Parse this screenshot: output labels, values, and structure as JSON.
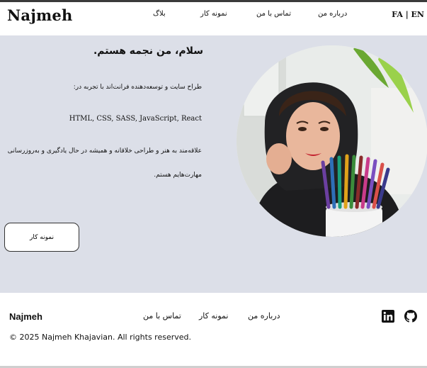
{
  "header": {
    "logo": "Najmeh",
    "nav": {
      "blog": "بلاگ",
      "portfolio": "نمونه کار",
      "contact": "تماس با من",
      "about": "درباره من"
    },
    "lang": {
      "fa": "FA",
      "sep": " | ",
      "en": "EN"
    }
  },
  "hero": {
    "title": "سلام، من نجمه هستم.",
    "intro": "طراح سایت و توسعه‌دهنده فرانت‌اند با تجربه در:",
    "skills": "HTML, CSS, SASS, JavaScript, React",
    "passion_line1": "علاقه‌مند به هنر و طراحی خلاقانه و همیشه در حال یادگیری و به‌روزرسانی",
    "passion_line2": "مهارت‌هایم هستم.",
    "cta": "نمونه کار"
  },
  "footer": {
    "logo": "Najmeh",
    "nav": {
      "contact": "تماس با من",
      "portfolio": "نمونه کار",
      "about": "درباره من"
    },
    "copyright": "© 2025 Najmeh Khajavian. All rights reserved.",
    "social": [
      {
        "name": "linkedin-icon"
      },
      {
        "name": "github-icon"
      }
    ]
  },
  "colors": {
    "hero_background": "#dcdfe8",
    "footer_background": "#ffffff",
    "text": "#111111",
    "accent_green": "#8cc63f"
  }
}
